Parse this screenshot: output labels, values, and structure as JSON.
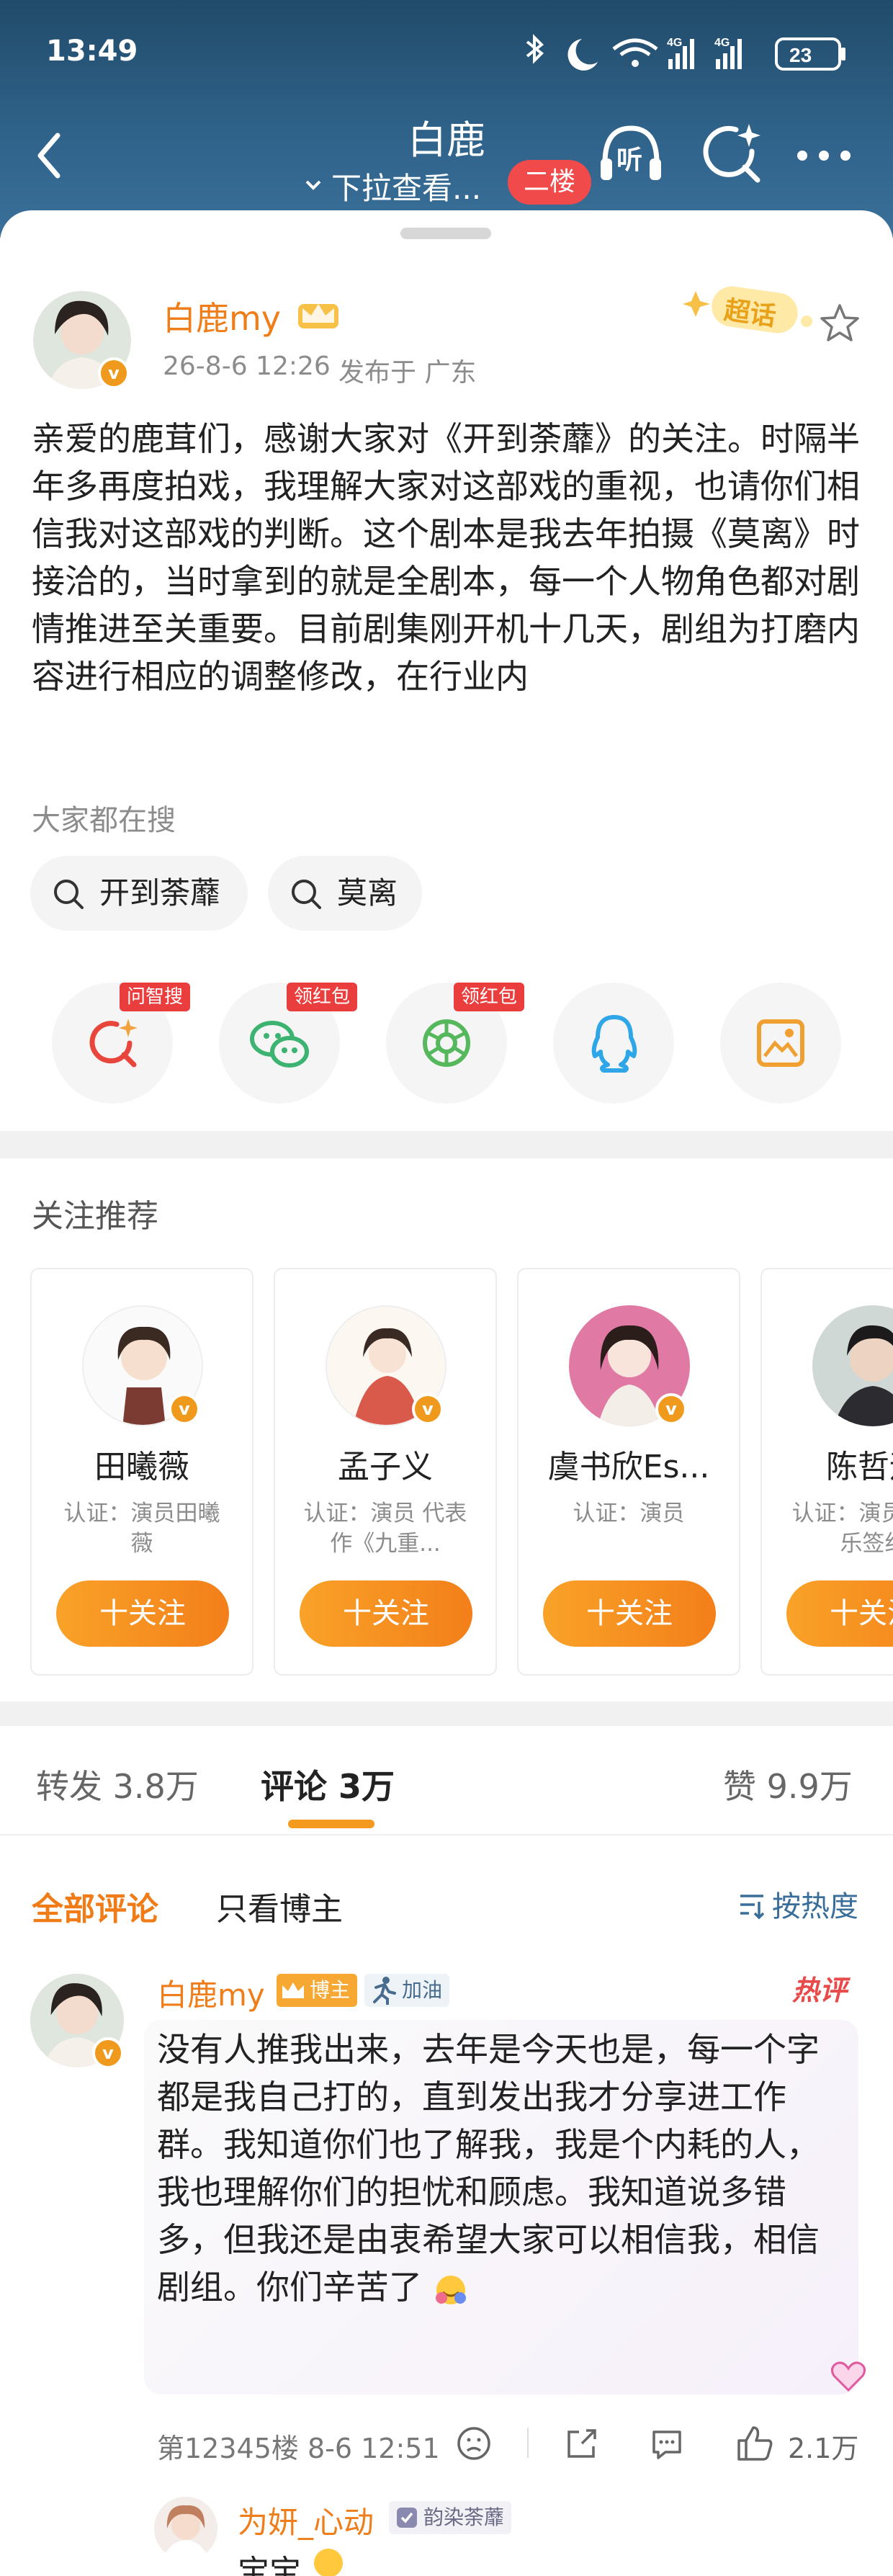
{
  "status_bar": {
    "time": "13:49",
    "network_1": "4G",
    "network_2": "4G",
    "battery": "23"
  },
  "header": {
    "title": "白鹿",
    "subtitle": "下拉查看...",
    "floor_badge": "二楼"
  },
  "post": {
    "author": "白鹿my",
    "timestamp": "26-8-6 12:26",
    "location": "发布于 广东",
    "supertopic_badge": "超话",
    "text": "亲爱的鹿茸们，感谢大家对《开到荼蘼》的关注。时隔半年多再度拍戏，我理解大家对这部戏的重视，也请你们相信我对这部戏的判断。这个剧本是我去年拍摄《莫离》时接洽的，当时拿到的就是全剧本，每一个人物角色都对剧情推进至关重要。目前剧集刚开机十几天，剧组为打磨内容进行相应的调整修改，在行业内"
  },
  "search_section": {
    "label": "大家都在搜",
    "chips": [
      "开到荼蘼",
      "莫离"
    ]
  },
  "share_row": {
    "items": [
      {
        "icon": "ai-search-icon",
        "tag": "问智搜",
        "color": "#e8453c"
      },
      {
        "icon": "wechat-icon",
        "tag": "领红包",
        "color": "#3cb371"
      },
      {
        "icon": "moments-icon",
        "tag": "领红包",
        "color": "#55b85c"
      },
      {
        "icon": "qq-icon",
        "tag": "",
        "color": "#2ea6e8"
      },
      {
        "icon": "save-image-icon",
        "tag": "",
        "color": "#f0a030"
      }
    ]
  },
  "recommend": {
    "title": "关注推荐",
    "follow_label": "十关注",
    "cards": [
      {
        "name": "田曦薇",
        "cert": "认证：演员田曦薇"
      },
      {
        "name": "孟子义",
        "cert": "认证：演员 代表作《九重..."
      },
      {
        "name": "虞书欣Es...",
        "cert": "认证：演员"
      },
      {
        "name": "陈哲远",
        "cert": "认证：演员 然娱乐签约"
      }
    ]
  },
  "tabs": {
    "repost": "转发 3.8万",
    "comment": "评论 3万",
    "like": "赞 9.9万"
  },
  "comment_filter": {
    "all": "全部评论",
    "author_only": "只看博主",
    "sort": "按热度"
  },
  "comment": {
    "author": "白鹿my",
    "role_tag": "博主",
    "cheer_tag": "加油",
    "hot_tag": "热评",
    "text": "没有人推我出来，去年是今天也是，每一个字都是我自己打的，直到发出我才分享进工作群。我知道你们也了解我，我是个内耗的人，我也理解你们的担忧和顾虑。我知道说多错多，但我还是由衷希望大家可以相信我，相信剧组。你们辛苦了",
    "floor_time": "第12345楼 8-6 12:51",
    "likes": "2.1万"
  },
  "reply": {
    "author": "为妍_心动",
    "tag": "韵染荼蘼",
    "text": "宝宝"
  }
}
